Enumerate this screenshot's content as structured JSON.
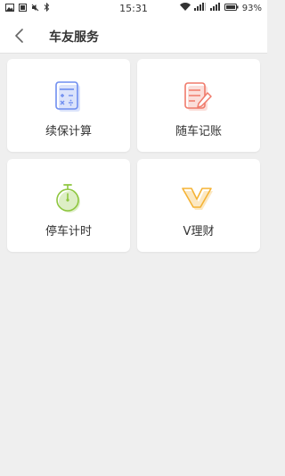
{
  "status_bar": {
    "time": "15:31",
    "battery": "93%",
    "icons": [
      "image-icon",
      "notification-icon",
      "mute-icon",
      "bluetooth-icon",
      "wifi-icon",
      "signal-icon",
      "battery-icon"
    ]
  },
  "nav": {
    "title": "车友服务",
    "back_icon": "chevron-left-icon"
  },
  "services": [
    {
      "label": "续保计算",
      "icon": "calculator-icon",
      "color": "#6f8ef0"
    },
    {
      "label": "随车记账",
      "icon": "notepad-edit-icon",
      "color": "#f07a6a"
    },
    {
      "label": "停车计时",
      "icon": "stopwatch-icon",
      "color": "#8ec63f"
    },
    {
      "label": "V理财",
      "icon": "v-finance-icon",
      "color": "#f5b335"
    }
  ]
}
